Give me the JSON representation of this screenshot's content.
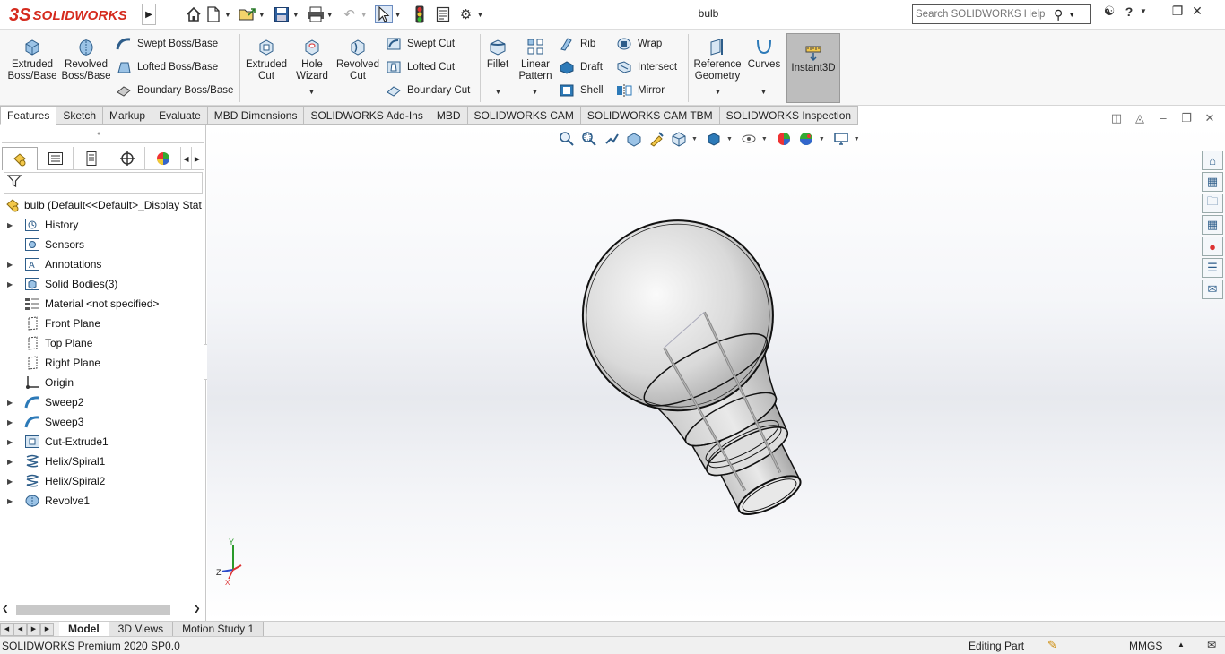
{
  "app": {
    "logo_ds": "3S",
    "logo_text": "SOLIDWORKS",
    "doc_title": "bulb",
    "search_placeholder": "Search SOLIDWORKS Help"
  },
  "quick_access": [
    "home-icon",
    "new-document-icon",
    "open-icon",
    "save-icon",
    "print-icon",
    "undo-icon",
    "select-icon",
    "traffic-light-icon",
    "file-properties-icon",
    "options-icon"
  ],
  "command_manager": {
    "extruded_boss": "Extruded\nBoss/Base",
    "revolved_boss": "Revolved\nBoss/Base",
    "swept_boss": "Swept Boss/Base",
    "lofted_boss": "Lofted Boss/Base",
    "boundary_boss": "Boundary Boss/Base",
    "extruded_cut": "Extruded\nCut",
    "hole_wizard": "Hole\nWizard",
    "revolved_cut": "Revolved\nCut",
    "swept_cut": "Swept Cut",
    "lofted_cut": "Lofted Cut",
    "boundary_cut": "Boundary Cut",
    "fillet": "Fillet",
    "linear_pattern": "Linear\nPattern",
    "rib": "Rib",
    "draft": "Draft",
    "shell": "Shell",
    "wrap": "Wrap",
    "intersect": "Intersect",
    "mirror": "Mirror",
    "reference_geometry": "Reference\nGeometry",
    "curves": "Curves",
    "instant3d": "Instant3D"
  },
  "tabs": [
    "Features",
    "Sketch",
    "Markup",
    "Evaluate",
    "MBD Dimensions",
    "SOLIDWORKS Add-Ins",
    "MBD",
    "SOLIDWORKS CAM",
    "SOLIDWORKS CAM TBM",
    "SOLIDWORKS Inspection"
  ],
  "active_tab": "Features",
  "feature_tree": {
    "root": "bulb  (Default<<Default>_Display Stat",
    "items": [
      {
        "label": "History",
        "icon": "history-icon",
        "expandable": true
      },
      {
        "label": "Sensors",
        "icon": "sensors-icon",
        "expandable": false
      },
      {
        "label": "Annotations",
        "icon": "annotations-icon",
        "expandable": true
      },
      {
        "label": "Solid Bodies(3)",
        "icon": "solid-bodies-icon",
        "expandable": true
      },
      {
        "label": "Material <not specified>",
        "icon": "material-icon",
        "expandable": false
      },
      {
        "label": "Front Plane",
        "icon": "plane-icon",
        "expandable": false
      },
      {
        "label": "Top Plane",
        "icon": "plane-icon",
        "expandable": false
      },
      {
        "label": "Right Plane",
        "icon": "plane-icon",
        "expandable": false
      },
      {
        "label": "Origin",
        "icon": "origin-icon",
        "expandable": false
      },
      {
        "label": "Sweep2",
        "icon": "sweep-icon",
        "expandable": true
      },
      {
        "label": "Sweep3",
        "icon": "sweep-icon",
        "expandable": true
      },
      {
        "label": "Cut-Extrude1",
        "icon": "cut-extrude-icon",
        "expandable": true
      },
      {
        "label": "Helix/Spiral1",
        "icon": "helix-icon",
        "expandable": true
      },
      {
        "label": "Helix/Spiral2",
        "icon": "helix-icon",
        "expandable": true
      },
      {
        "label": "Revolve1",
        "icon": "revolve-icon",
        "expandable": true
      }
    ]
  },
  "triad": {
    "y": "Y",
    "z": "Z",
    "x": "X"
  },
  "bottom_tabs": [
    "Model",
    "3D Views",
    "Motion Study 1"
  ],
  "active_bottom_tab": "Model",
  "status": {
    "product": "SOLIDWORKS Premium 2020 SP0.0",
    "mode": "Editing Part",
    "units": "MMGS"
  },
  "colors": {
    "accent": "#d52b1e",
    "tree_blue": "#4a90c8",
    "instant3d_bg": "#bdbdbd"
  }
}
